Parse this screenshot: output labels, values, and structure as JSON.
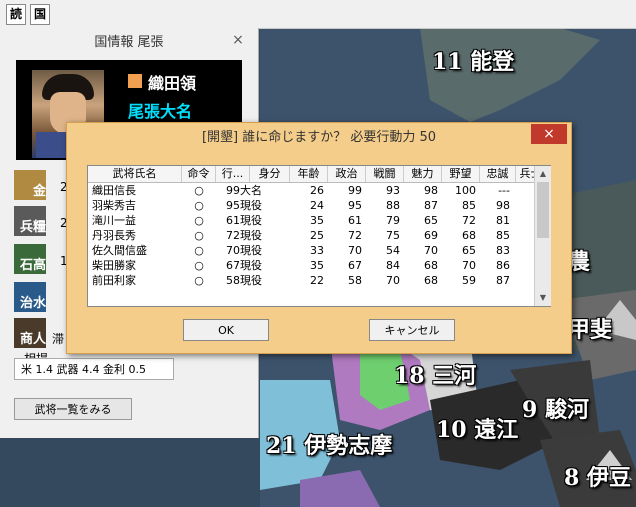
{
  "toolbar": {
    "btn1": "読",
    "btn2": "国"
  },
  "map": {
    "labels": {
      "noto": "11 能登",
      "shinano": "農",
      "kai": "甲斐",
      "mikawa": "18 三河",
      "suruga": "9 駿河",
      "totomi": "10 遠江",
      "ise": "21 伊勢志摩",
      "izu": "8 伊豆"
    }
  },
  "info_panel": {
    "title": "国情報 尾張",
    "close": "×",
    "lord_title": "織田領",
    "lord_rank": "尾張大名",
    "stats": [
      {
        "icon": "金",
        "value": "2"
      },
      {
        "icon": "兵糧",
        "value": "2"
      },
      {
        "icon": "石高",
        "value": "1"
      },
      {
        "icon": "治水",
        "value": ""
      },
      {
        "icon": "商人",
        "value": "滞"
      }
    ],
    "sobo_label": "相場",
    "sobo_text": "米 1.4 武器 4.4 金利 0.5",
    "bushou_button": "武将一覧をみる"
  },
  "dialog": {
    "title": "[開墾] 誰に命じますか？ 必要行動力 50",
    "close": "×",
    "columns": [
      "武将氏名",
      "命令",
      "行...",
      "身分",
      "年齢",
      "政治",
      "戦闘",
      "魅力",
      "野望",
      "忠誠",
      "兵士"
    ],
    "rows": [
      {
        "name": "織田信長",
        "order": "○",
        "action": "99",
        "rank": "大名",
        "age": "26",
        "politics": "99",
        "combat": "93",
        "charm": "98",
        "ambition": "100",
        "loyalty": "---"
      },
      {
        "name": "羽柴秀吉",
        "order": "○",
        "action": "95",
        "rank": "現役",
        "age": "24",
        "politics": "95",
        "combat": "88",
        "charm": "87",
        "ambition": "85",
        "loyalty": "98"
      },
      {
        "name": "滝川一益",
        "order": "○",
        "action": "61",
        "rank": "現役",
        "age": "35",
        "politics": "61",
        "combat": "79",
        "charm": "65",
        "ambition": "72",
        "loyalty": "81"
      },
      {
        "name": "丹羽長秀",
        "order": "○",
        "action": "72",
        "rank": "現役",
        "age": "25",
        "politics": "72",
        "combat": "75",
        "charm": "69",
        "ambition": "68",
        "loyalty": "85"
      },
      {
        "name": "佐久間信盛",
        "order": "○",
        "action": "70",
        "rank": "現役",
        "age": "33",
        "politics": "70",
        "combat": "54",
        "charm": "70",
        "ambition": "65",
        "loyalty": "83"
      },
      {
        "name": "柴田勝家",
        "order": "○",
        "action": "67",
        "rank": "現役",
        "age": "35",
        "politics": "67",
        "combat": "84",
        "charm": "68",
        "ambition": "70",
        "loyalty": "86"
      },
      {
        "name": "前田利家",
        "order": "○",
        "action": "58",
        "rank": "現役",
        "age": "22",
        "politics": "58",
        "combat": "70",
        "charm": "68",
        "ambition": "59",
        "loyalty": "87"
      }
    ],
    "ok_button": "OK",
    "cancel_button": "キャンセル"
  }
}
